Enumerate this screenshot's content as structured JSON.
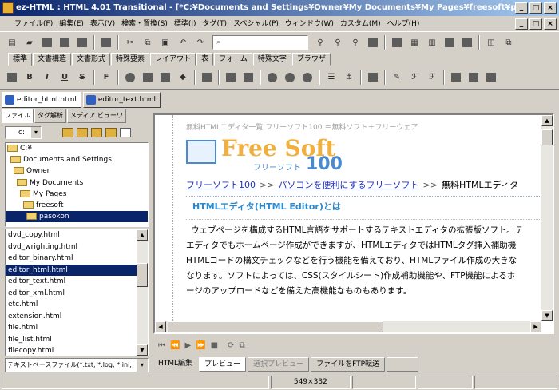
{
  "window": {
    "title": "ez-HTML : HTML 4.01 Transitional - [*C:¥Documents and Settings¥Owner¥My Documents¥My Pages¥freesoft¥p...",
    "minimize": "_",
    "maximize": "□",
    "close": "×"
  },
  "menu": [
    "ファイル(F)",
    "編集(E)",
    "表示(V)",
    "検索・置換(S)",
    "標準(I)",
    "タグ(T)",
    "スペシャル(P)",
    "ウィンドウ(W)",
    "カスタム(M)",
    "ヘルプ(H)"
  ],
  "search": {
    "placeholder": ""
  },
  "toolbar_tabs": [
    "標準",
    "文書構造",
    "文書形式",
    "特殊要素",
    "レイアウト",
    "表",
    "フォーム",
    "特殊文字",
    "ブラウザ"
  ],
  "format_buttons": {
    "bold": "B",
    "italic": "I",
    "underline": "U",
    "strike": "S",
    "font": "F"
  },
  "doc_tabs": [
    "editor_html.html",
    "editor_text.html"
  ],
  "left_tabs": [
    "ファイル",
    "タグ解析",
    "メディア ビューワ"
  ],
  "drive": "c:",
  "folder_tree": [
    "C:¥",
    "Documents and Settings",
    "Owner",
    "My Documents",
    "My Pages",
    "freesoft",
    "pasokon"
  ],
  "folder_tree_selected": 6,
  "file_list": [
    "dvd_copy.html",
    "dvd_wrighting.html",
    "editor_binary.html",
    "editor_html.html",
    "editor_text.html",
    "editor_xml.html",
    "etc.html",
    "extension.html",
    "file.html",
    "file_list.html",
    "filecopy.html"
  ],
  "file_list_selected": 3,
  "file_filter": "テキストベースファイル(*.txt; *.log; *.ini;",
  "page": {
    "header_small": "無料HTMLエディタ一覧 フリーソフト100 ＝無料ソフト＋フリーウェア",
    "logo_main": "Free Soft",
    "logo_sub": "フリーソフト",
    "logo_num": "100",
    "crumb1": "フリーソフト100",
    "crumb_sep": ">>",
    "crumb2": "パソコンを便利にするフリーソフト",
    "crumb3": "無料HTMLエディタ",
    "heading": "HTMLエディタ(HTML Editor)とは",
    "para_lines": [
      "ウェブページを構成するHTML言語をサポートするテキストエディタの拡張版ソフト。テ",
      "エディタでもホームページ作成ができますが、HTMLエディタではHTMLタグ挿入補助機",
      "HTMLコードの構文チェックなどを行う機能を備えており、HTMLファイル作成の大きな",
      "なります。ソフトによっては、CSS(スタイルシート)作成補助機能や、FTP機能によるホ",
      "ージのアップロードなどを備えた高機能なものもあります。"
    ]
  },
  "view_tabs": [
    "HTML編集",
    "プレビュー",
    "選択プレビュー",
    "ファイルをFTP転送"
  ],
  "view_tabs_active": 1,
  "status": {
    "size": "549×332"
  }
}
